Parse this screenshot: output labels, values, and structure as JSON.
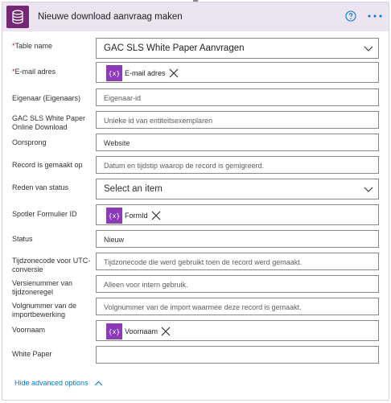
{
  "header": {
    "title": "Nieuwe download aanvraag maken",
    "app_icon": "database-icon",
    "help_icon": "help-icon",
    "more_icon": "more-icon",
    "accent_color": "#742774",
    "header_bg": "#ece4f0"
  },
  "fields": {
    "table_name": {
      "label": "Table name",
      "required": "*",
      "value": "GAC SLS White Paper Aanvragen"
    },
    "email": {
      "label": "E-mail adres",
      "required": "*",
      "token": "E-mail adres",
      "token_icon": "{x}"
    },
    "owner": {
      "label": "Eigenaar (Eigenaars)",
      "placeholder": "Eigenaar-id"
    },
    "download_id": {
      "label": "GAC SLS White Paper Online Download",
      "placeholder": "Unieke id van entiteitsexemplaren"
    },
    "origin": {
      "label": "Oorsprong",
      "value": "Website"
    },
    "created_on": {
      "label": "Record is gemaakt op",
      "placeholder": "Datum en tijdstip waarop de record is gemigreerd."
    },
    "status_reason": {
      "label": "Reden van status",
      "placeholder": "Select an item"
    },
    "form_id": {
      "label": "Spotler Formulier ID",
      "token": "FormId",
      "token_icon": "{x}"
    },
    "status": {
      "label": "Status",
      "value": "Nieuw"
    },
    "utc_offset": {
      "label": "Tijdzonecode voor UTC-conversie",
      "placeholder": "Tijdzonecode die werd gebruikt toen de record werd gemaakt."
    },
    "tz_rule_version": {
      "label": "Versienummer van tijdzoneregel",
      "placeholder": "Alleen voor intern gebruik."
    },
    "import_seq": {
      "label": "Volgnummer van de importbewerking",
      "placeholder": "Volgnummer van de import waarmee deze record is gemaakt."
    },
    "first_name": {
      "label": "Voornaam",
      "token": "Voornaam",
      "token_icon": "{x}"
    },
    "white_paper": {
      "label": "White Paper",
      "value": ""
    }
  },
  "footer": {
    "advanced_label": "Hide advanced options"
  },
  "colors": {
    "token": "#8c3ab7",
    "link": "#0078d4",
    "required": "#a4262c"
  }
}
